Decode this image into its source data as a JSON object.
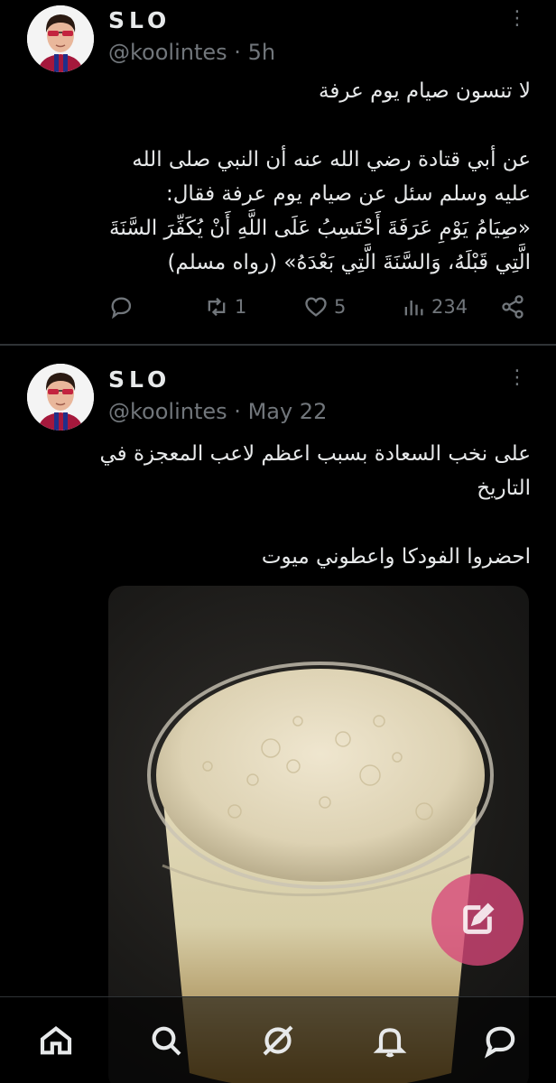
{
  "tweets": [
    {
      "display_name": "SLO",
      "handle": "@koolintes",
      "separator": "·",
      "time": "5h",
      "more_label": "⋮",
      "text_paragraphs": [
        "لا تنسون صيام يوم عرفة",
        "عن أبي قتادة رضي الله عنه أن النبي صلى الله عليه وسلم سئل عن صيام يوم عرفة فقال:\n«صِيَامُ يَوْمِ عَرَفَةَ أَحْتَسِبُ عَلَى اللَّهِ أَنْ يُكَفِّرَ السَّنَةَ الَّتِي قَبْلَهُ، وَالسَّنَةَ الَّتِي بَعْدَهُ» (رواه مسلم)"
      ],
      "replies": "",
      "reposts": "1",
      "likes": "5",
      "views": "234"
    },
    {
      "display_name": "SLO",
      "handle": "@koolintes",
      "separator": "·",
      "time": "May 22",
      "more_label": "⋮",
      "text_paragraphs": [
        "على نخب السعادة بسبب اعظم لاعب المعجزة في التاريخ",
        "احضروا الفودكا واعطوني ميوت"
      ]
    }
  ],
  "icons": {
    "reply": "reply-icon",
    "repost": "repost-icon",
    "like": "heart-icon",
    "views": "views-icon",
    "share": "share-icon",
    "compose": "compose-icon",
    "home": "home-icon",
    "search": "search-icon",
    "grok": "grok-icon",
    "notifications": "bell-icon",
    "messages": "messages-icon"
  },
  "colors": {
    "background": "#000000",
    "text_primary": "#e7e9ea",
    "text_secondary": "#71767b",
    "fab": "#d74678"
  }
}
